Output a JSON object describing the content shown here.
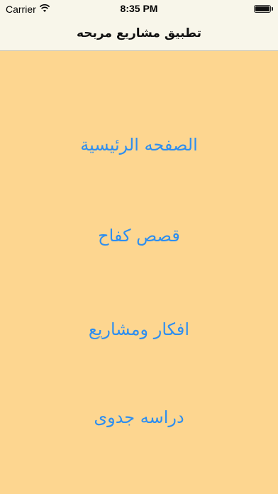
{
  "status_bar": {
    "carrier": "Carrier",
    "time": "8:35 PM",
    "wifi_icon": "wifi-icon",
    "battery_icon": "battery-full-icon"
  },
  "nav_bar": {
    "title": "تطبيق مشاريع مربحه"
  },
  "menu": {
    "items": [
      {
        "label": "الصفحه الرئيسية"
      },
      {
        "label": "قصص كفاح"
      },
      {
        "label": "افكار ومشاريع"
      },
      {
        "label": "دراسه جدوى"
      }
    ]
  },
  "colors": {
    "background": "#fdd690",
    "nav_background": "#f8f6ea",
    "link": "#2d8ef0"
  }
}
